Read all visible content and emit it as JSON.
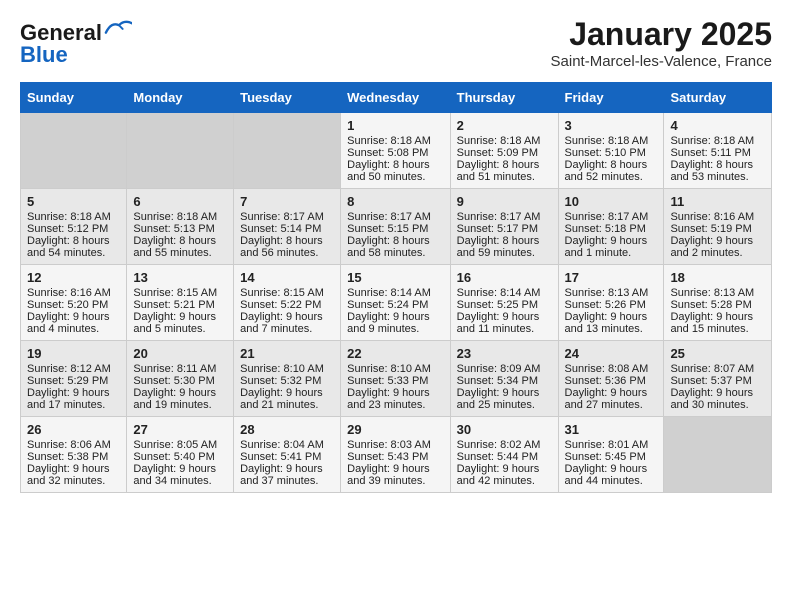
{
  "header": {
    "logo_line1": "General",
    "logo_line2": "Blue",
    "month": "January 2025",
    "location": "Saint-Marcel-les-Valence, France"
  },
  "weekdays": [
    "Sunday",
    "Monday",
    "Tuesday",
    "Wednesday",
    "Thursday",
    "Friday",
    "Saturday"
  ],
  "weeks": [
    [
      {
        "day": "",
        "sunrise": "",
        "sunset": "",
        "daylight": ""
      },
      {
        "day": "",
        "sunrise": "",
        "sunset": "",
        "daylight": ""
      },
      {
        "day": "",
        "sunrise": "",
        "sunset": "",
        "daylight": ""
      },
      {
        "day": "1",
        "sunrise": "Sunrise: 8:18 AM",
        "sunset": "Sunset: 5:08 PM",
        "daylight": "Daylight: 8 hours and 50 minutes."
      },
      {
        "day": "2",
        "sunrise": "Sunrise: 8:18 AM",
        "sunset": "Sunset: 5:09 PM",
        "daylight": "Daylight: 8 hours and 51 minutes."
      },
      {
        "day": "3",
        "sunrise": "Sunrise: 8:18 AM",
        "sunset": "Sunset: 5:10 PM",
        "daylight": "Daylight: 8 hours and 52 minutes."
      },
      {
        "day": "4",
        "sunrise": "Sunrise: 8:18 AM",
        "sunset": "Sunset: 5:11 PM",
        "daylight": "Daylight: 8 hours and 53 minutes."
      }
    ],
    [
      {
        "day": "5",
        "sunrise": "Sunrise: 8:18 AM",
        "sunset": "Sunset: 5:12 PM",
        "daylight": "Daylight: 8 hours and 54 minutes."
      },
      {
        "day": "6",
        "sunrise": "Sunrise: 8:18 AM",
        "sunset": "Sunset: 5:13 PM",
        "daylight": "Daylight: 8 hours and 55 minutes."
      },
      {
        "day": "7",
        "sunrise": "Sunrise: 8:17 AM",
        "sunset": "Sunset: 5:14 PM",
        "daylight": "Daylight: 8 hours and 56 minutes."
      },
      {
        "day": "8",
        "sunrise": "Sunrise: 8:17 AM",
        "sunset": "Sunset: 5:15 PM",
        "daylight": "Daylight: 8 hours and 58 minutes."
      },
      {
        "day": "9",
        "sunrise": "Sunrise: 8:17 AM",
        "sunset": "Sunset: 5:17 PM",
        "daylight": "Daylight: 8 hours and 59 minutes."
      },
      {
        "day": "10",
        "sunrise": "Sunrise: 8:17 AM",
        "sunset": "Sunset: 5:18 PM",
        "daylight": "Daylight: 9 hours and 1 minute."
      },
      {
        "day": "11",
        "sunrise": "Sunrise: 8:16 AM",
        "sunset": "Sunset: 5:19 PM",
        "daylight": "Daylight: 9 hours and 2 minutes."
      }
    ],
    [
      {
        "day": "12",
        "sunrise": "Sunrise: 8:16 AM",
        "sunset": "Sunset: 5:20 PM",
        "daylight": "Daylight: 9 hours and 4 minutes."
      },
      {
        "day": "13",
        "sunrise": "Sunrise: 8:15 AM",
        "sunset": "Sunset: 5:21 PM",
        "daylight": "Daylight: 9 hours and 5 minutes."
      },
      {
        "day": "14",
        "sunrise": "Sunrise: 8:15 AM",
        "sunset": "Sunset: 5:22 PM",
        "daylight": "Daylight: 9 hours and 7 minutes."
      },
      {
        "day": "15",
        "sunrise": "Sunrise: 8:14 AM",
        "sunset": "Sunset: 5:24 PM",
        "daylight": "Daylight: 9 hours and 9 minutes."
      },
      {
        "day": "16",
        "sunrise": "Sunrise: 8:14 AM",
        "sunset": "Sunset: 5:25 PM",
        "daylight": "Daylight: 9 hours and 11 minutes."
      },
      {
        "day": "17",
        "sunrise": "Sunrise: 8:13 AM",
        "sunset": "Sunset: 5:26 PM",
        "daylight": "Daylight: 9 hours and 13 minutes."
      },
      {
        "day": "18",
        "sunrise": "Sunrise: 8:13 AM",
        "sunset": "Sunset: 5:28 PM",
        "daylight": "Daylight: 9 hours and 15 minutes."
      }
    ],
    [
      {
        "day": "19",
        "sunrise": "Sunrise: 8:12 AM",
        "sunset": "Sunset: 5:29 PM",
        "daylight": "Daylight: 9 hours and 17 minutes."
      },
      {
        "day": "20",
        "sunrise": "Sunrise: 8:11 AM",
        "sunset": "Sunset: 5:30 PM",
        "daylight": "Daylight: 9 hours and 19 minutes."
      },
      {
        "day": "21",
        "sunrise": "Sunrise: 8:10 AM",
        "sunset": "Sunset: 5:32 PM",
        "daylight": "Daylight: 9 hours and 21 minutes."
      },
      {
        "day": "22",
        "sunrise": "Sunrise: 8:10 AM",
        "sunset": "Sunset: 5:33 PM",
        "daylight": "Daylight: 9 hours and 23 minutes."
      },
      {
        "day": "23",
        "sunrise": "Sunrise: 8:09 AM",
        "sunset": "Sunset: 5:34 PM",
        "daylight": "Daylight: 9 hours and 25 minutes."
      },
      {
        "day": "24",
        "sunrise": "Sunrise: 8:08 AM",
        "sunset": "Sunset: 5:36 PM",
        "daylight": "Daylight: 9 hours and 27 minutes."
      },
      {
        "day": "25",
        "sunrise": "Sunrise: 8:07 AM",
        "sunset": "Sunset: 5:37 PM",
        "daylight": "Daylight: 9 hours and 30 minutes."
      }
    ],
    [
      {
        "day": "26",
        "sunrise": "Sunrise: 8:06 AM",
        "sunset": "Sunset: 5:38 PM",
        "daylight": "Daylight: 9 hours and 32 minutes."
      },
      {
        "day": "27",
        "sunrise": "Sunrise: 8:05 AM",
        "sunset": "Sunset: 5:40 PM",
        "daylight": "Daylight: 9 hours and 34 minutes."
      },
      {
        "day": "28",
        "sunrise": "Sunrise: 8:04 AM",
        "sunset": "Sunset: 5:41 PM",
        "daylight": "Daylight: 9 hours and 37 minutes."
      },
      {
        "day": "29",
        "sunrise": "Sunrise: 8:03 AM",
        "sunset": "Sunset: 5:43 PM",
        "daylight": "Daylight: 9 hours and 39 minutes."
      },
      {
        "day": "30",
        "sunrise": "Sunrise: 8:02 AM",
        "sunset": "Sunset: 5:44 PM",
        "daylight": "Daylight: 9 hours and 42 minutes."
      },
      {
        "day": "31",
        "sunrise": "Sunrise: 8:01 AM",
        "sunset": "Sunset: 5:45 PM",
        "daylight": "Daylight: 9 hours and 44 minutes."
      },
      {
        "day": "",
        "sunrise": "",
        "sunset": "",
        "daylight": ""
      }
    ]
  ]
}
